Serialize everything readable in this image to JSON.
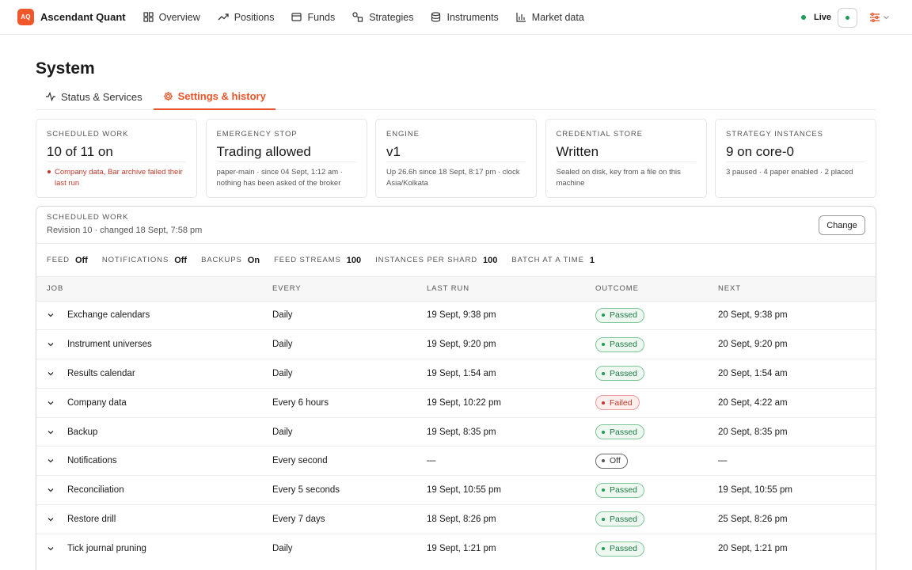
{
  "brand": {
    "logo_text": "AQ",
    "name": "Ascendant Quant",
    "accent": "#f0572b"
  },
  "nav": [
    {
      "label": "Overview",
      "icon": "grid-icon"
    },
    {
      "label": "Positions",
      "icon": "trend-up-icon"
    },
    {
      "label": "Funds",
      "icon": "wallet-icon"
    },
    {
      "label": "Strategies",
      "icon": "strategy-icon"
    },
    {
      "label": "Instruments",
      "icon": "database-icon"
    },
    {
      "label": "Market data",
      "icon": "bar-chart-icon"
    }
  ],
  "status": {
    "label": "Live",
    "color": "#1f9d55"
  },
  "page": {
    "title": "System"
  },
  "tabs": [
    {
      "label": "Status & Services",
      "icon": "pulse-icon",
      "active": false
    },
    {
      "label": "Settings & history",
      "icon": "gear-icon",
      "active": true
    }
  ],
  "cards": [
    {
      "label": "SCHEDULED WORK",
      "value": "10 of 11 on",
      "sub": "Company data, Bar archive failed their last run",
      "error": true
    },
    {
      "label": "EMERGENCY STOP",
      "value": "Trading allowed",
      "sub": "paper-main · since 04 Sept, 1:12 am · nothing has been asked of the broker",
      "error": false
    },
    {
      "label": "ENGINE",
      "value": "v1",
      "sub": "Up 26.6h since 18 Sept, 8:17 pm · clock Asia/Kolkata",
      "error": false
    },
    {
      "label": "CREDENTIAL STORE",
      "value": "Written",
      "sub": "Sealed on disk, key from a file on this machine",
      "error": false
    },
    {
      "label": "STRATEGY INSTANCES",
      "value": "9 on core-0",
      "sub": "3 paused · 4 paper enabled · 2 placed",
      "error": false
    }
  ],
  "schedule": {
    "label": "SCHEDULED WORK",
    "revision": "Revision 10 · changed 18 Sept, 7:58 pm",
    "change_label": "Change",
    "settings": [
      {
        "key": "FEED",
        "value": "Off"
      },
      {
        "key": "NOTIFICATIONS",
        "value": "Off"
      },
      {
        "key": "BACKUPS",
        "value": "On"
      },
      {
        "key": "FEED STREAMS",
        "value": "100"
      },
      {
        "key": "INSTANCES PER SHARD",
        "value": "100"
      },
      {
        "key": "BATCH AT A TIME",
        "value": "1"
      }
    ],
    "columns": [
      "JOB",
      "EVERY",
      "LAST RUN",
      "OUTCOME",
      "NEXT"
    ],
    "rows": [
      {
        "job": "Exchange calendars",
        "every": "Daily",
        "last": "19 Sept, 9:38 pm",
        "outcome": "Passed",
        "status": "passed",
        "next": "20 Sept, 9:38 pm"
      },
      {
        "job": "Instrument universes",
        "every": "Daily",
        "last": "19 Sept, 9:20 pm",
        "outcome": "Passed",
        "status": "passed",
        "next": "20 Sept, 9:20 pm"
      },
      {
        "job": "Results calendar",
        "every": "Daily",
        "last": "19 Sept, 1:54 am",
        "outcome": "Passed",
        "status": "passed",
        "next": "20 Sept, 1:54 am"
      },
      {
        "job": "Company data",
        "every": "Every 6 hours",
        "last": "19 Sept, 10:22 pm",
        "outcome": "Failed",
        "status": "failed",
        "next": "20 Sept, 4:22 am"
      },
      {
        "job": "Backup",
        "every": "Daily",
        "last": "19 Sept, 8:35 pm",
        "outcome": "Passed",
        "status": "passed",
        "next": "20 Sept, 8:35 pm"
      },
      {
        "job": "Notifications",
        "every": "Every second",
        "last": "—",
        "outcome": "Off",
        "status": "off",
        "next": "—"
      },
      {
        "job": "Reconciliation",
        "every": "Every 5 seconds",
        "last": "19 Sept, 10:55 pm",
        "outcome": "Passed",
        "status": "passed",
        "next": "19 Sept, 10:55 pm"
      },
      {
        "job": "Restore drill",
        "every": "Every 7 days",
        "last": "18 Sept, 8:26 pm",
        "outcome": "Passed",
        "status": "passed",
        "next": "25 Sept, 8:26 pm"
      },
      {
        "job": "Tick journal pruning",
        "every": "Daily",
        "last": "19 Sept, 1:21 pm",
        "outcome": "Passed",
        "status": "passed",
        "next": "20 Sept, 1:21 pm"
      }
    ]
  }
}
